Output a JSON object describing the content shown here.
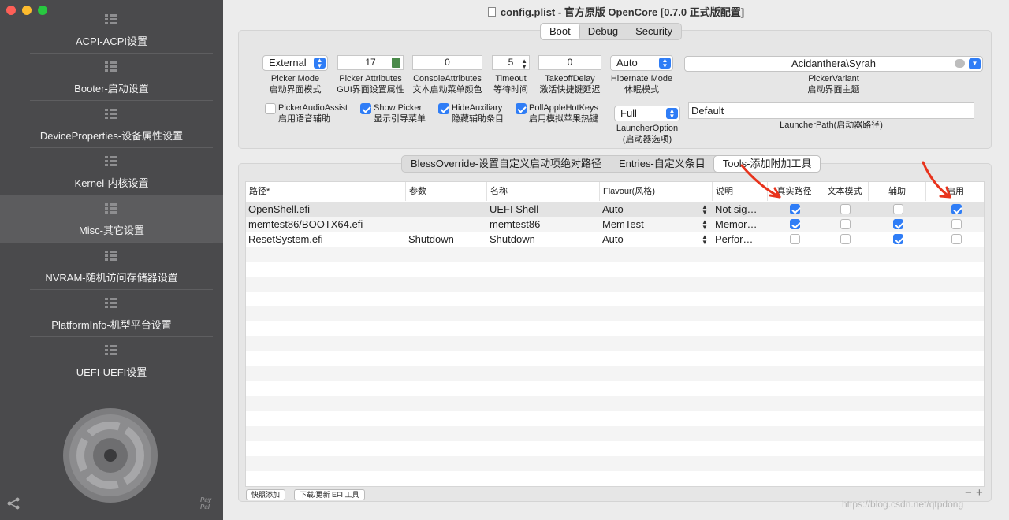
{
  "window": {
    "title": "config.plist - 官方原版 OpenCore [0.7.0 正式版配置]",
    "traffic_colors": [
      "#fe5f57",
      "#febc2e",
      "#28c840"
    ]
  },
  "sidebar": {
    "items": [
      {
        "label": "ACPI-ACPI设置"
      },
      {
        "label": "Booter-启动设置"
      },
      {
        "label": "DeviceProperties-设备属性设置"
      },
      {
        "label": "Kernel-内核设置"
      },
      {
        "label": "Misc-其它设置"
      },
      {
        "label": "NVRAM-随机访问存储器设置"
      },
      {
        "label": "PlatformInfo-机型平台设置"
      },
      {
        "label": "UEFI-UEFI设置"
      }
    ],
    "paypal_line1": "Pay",
    "paypal_line2": "Pal"
  },
  "top_tabs": [
    "Boot",
    "Debug",
    "Security"
  ],
  "boot": {
    "picker_mode": {
      "value": "External",
      "cap1": "Picker Mode",
      "cap2": "启动界面模式"
    },
    "picker_attributes": {
      "value": "17",
      "cap1": "Picker Attributes",
      "cap2": "GUI界面设置属性"
    },
    "console_attributes": {
      "value": "0",
      "cap1": "ConsoleAttributes",
      "cap2": "文本启动菜单颜色"
    },
    "timeout": {
      "value": "5",
      "cap1": "Timeout",
      "cap2": "等待时间"
    },
    "takeoff_delay": {
      "value": "0",
      "cap1": "TakeoffDelay",
      "cap2": "激活快捷键延迟"
    },
    "hibernate_mode": {
      "value": "Auto",
      "cap1": "Hibernate Mode",
      "cap2": "休眠模式"
    },
    "picker_variant": {
      "value": "Acidanthera\\Syrah",
      "cap1": "PickerVariant",
      "cap2": "启动界面主题"
    },
    "launcher_option": {
      "value": "Full",
      "cap1": "LauncherOption",
      "cap2": "(启动器选项)"
    },
    "launcher_path": {
      "value": "Default",
      "cap": "LauncherPath(启动器路径)"
    },
    "checks": [
      {
        "label1": "PickerAudioAssist",
        "label2": "启用语音辅助",
        "checked": false
      },
      {
        "label1": "Show Picker",
        "label2": "显示引导菜单",
        "checked": true
      },
      {
        "label1": "HideAuxiliary",
        "label2": "隐藏辅助条目",
        "checked": true
      },
      {
        "label1": "PollAppleHotKeys",
        "label2": "启用模拟苹果热键",
        "checked": true
      }
    ]
  },
  "sub_tabs": [
    "BlessOverride-设置自定义启动项绝对路径",
    "Entries-自定义条目",
    "Tools-添加附加工具"
  ],
  "table": {
    "headers": [
      "路径*",
      "参数",
      "名称",
      "Flavour(风格)",
      "说明",
      "真实路径",
      "文本模式",
      "辅助",
      "启用"
    ],
    "rows": [
      {
        "path": "OpenShell.efi",
        "args": "",
        "name": "UEFI Shell",
        "flavour": "Auto",
        "comment": "Not sig…",
        "realpath": true,
        "textmode": false,
        "aux": false,
        "enabled": true
      },
      {
        "path": "memtest86/BOOTX64.efi",
        "args": "",
        "name": "memtest86",
        "flavour": "MemTest",
        "comment": "Memor…",
        "realpath": true,
        "textmode": false,
        "aux": true,
        "enabled": false
      },
      {
        "path": "ResetSystem.efi",
        "args": "Shutdown",
        "name": "Shutdown",
        "flavour": "Auto",
        "comment": "Perfor…",
        "realpath": false,
        "textmode": false,
        "aux": true,
        "enabled": false
      }
    ]
  },
  "bottom_buttons": [
    "快照添加",
    "下载/更新 EFI 工具"
  ],
  "watermark": "https://blog.csdn.net/qtpdong",
  "annotation_color": "#e8331c"
}
